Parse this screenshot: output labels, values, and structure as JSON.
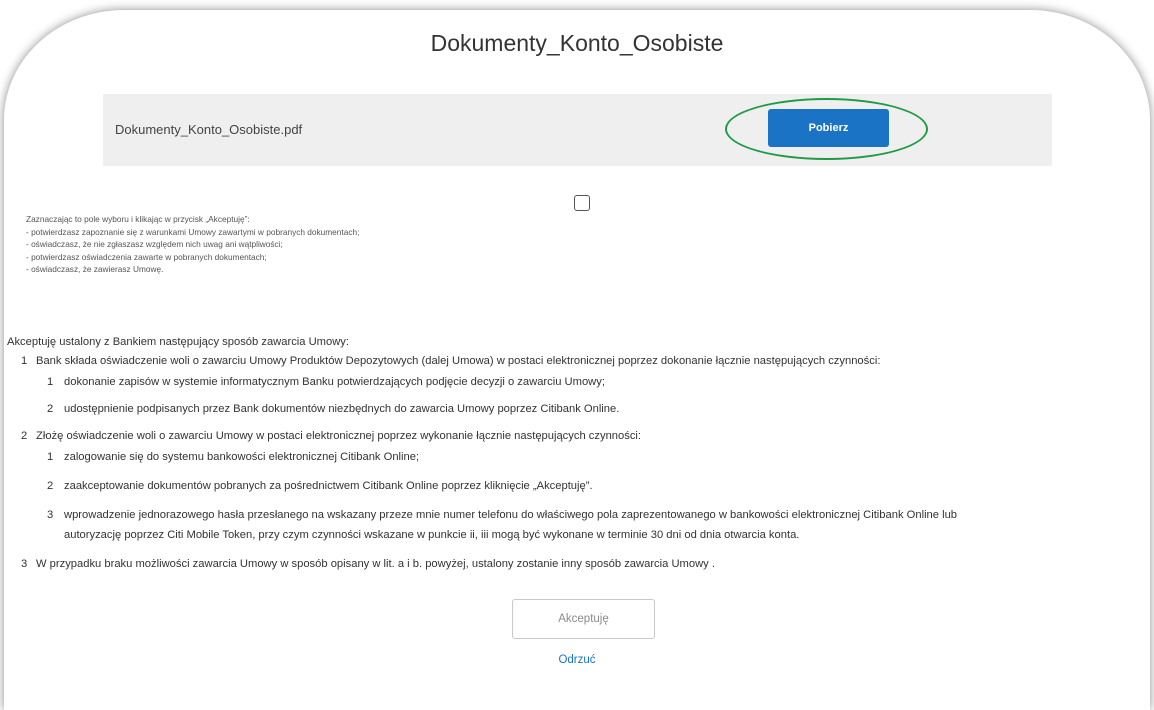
{
  "dialog": {
    "title": "Dokumenty_Konto_Osobiste"
  },
  "file": {
    "name": "Dokumenty_Konto_Osobiste.pdf",
    "download_label": "Pobierz"
  },
  "consent": {
    "intro": "Zaznaczając to pole wyboru i klikając w przycisk „Akceptuję”:",
    "points": [
      "- potwierdzasz zapoznanie się z warunkami Umowy zawartymi w pobranych dokumentach;",
      "- oświadczasz, że nie zgłaszasz względem nich uwag ani wątpliwości;",
      "- potwierdzasz oświadczenia zawarte w pobranych dokumentach;",
      "- oświadczasz, że zawierasz Umowę."
    ]
  },
  "terms": {
    "lead": "Akceptuję ustalony z Bankiem następujący sposób zawarcia Umowy:",
    "items": [
      {
        "num": "1",
        "text": "Bank składa oświadczenie woli o zawarciu Umowy Produktów Depozytowych (dalej Umowa) w postaci elektronicznej poprzez dokonanie łącznie następujących czynności:",
        "sub": [
          {
            "num": "1",
            "text": "dokonanie zapisów w systemie informatycznym Banku potwierdzających podjęcie decyzji o zawarciu Umowy;"
          },
          {
            "num": "2",
            "text": "udostępnienie podpisanych przez Bank dokumentów niezbędnych do zawarcia Umowy poprzez Citibank Online."
          }
        ]
      },
      {
        "num": "2",
        "text": "Złożę oświadczenie woli o zawarciu Umowy w postaci elektronicznej poprzez wykonanie łącznie następujących czynności:",
        "sub": [
          {
            "num": "1",
            "text": "zalogowanie się do systemu bankowości elektronicznej Citibank Online;"
          },
          {
            "num": "2",
            "text": " zaakceptowanie dokumentów pobranych za pośrednictwem Citibank Online poprzez kliknięcie „Akceptuję”."
          },
          {
            "num": "3",
            "text": "wprowadzenie jednorazowego hasła przesłanego na wskazany przeze mnie numer telefonu do właściwego pola zaprezentowanego w bankowości elektronicznej Citibank Online lub",
            "cont": "autoryzację poprzez Citi Mobile Token, przy czym czynności wskazane w punkcie ii, iii mogą być wykonane w terminie 30 dni od dnia otwarcia konta."
          }
        ]
      },
      {
        "num": "3",
        "text": "W przypadku braku możliwości zawarcia Umowy w sposób opisany w lit. a i b. powyżej, ustalony zostanie inny sposób zawarcia Umowy ."
      }
    ]
  },
  "actions": {
    "accept_label": "Akceptuję",
    "reject_label": "Odrzuć"
  },
  "colors": {
    "primary": "#1a73c5",
    "highlight": "#1f9b46"
  }
}
